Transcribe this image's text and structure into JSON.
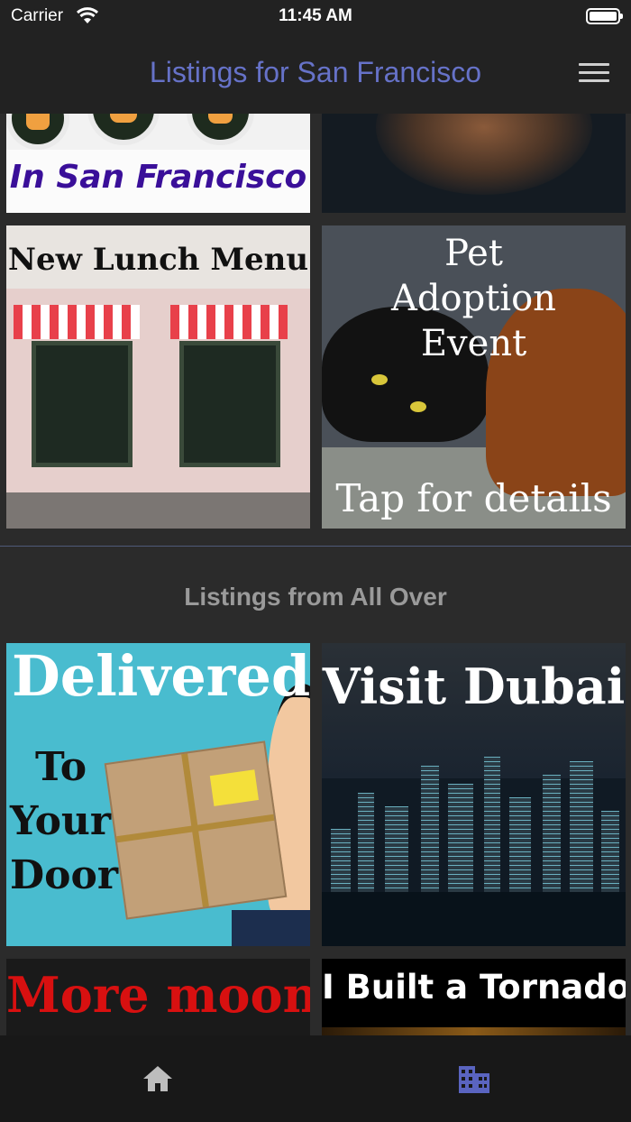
{
  "status_bar": {
    "carrier": "Carrier",
    "time": "11:45 AM",
    "battery_level": 1.0
  },
  "nav": {
    "title": "Listings for San Francisco",
    "title_color": "#6672c8",
    "menu_icon": "hamburger-menu-icon"
  },
  "local_listings": [
    {
      "caption": "In San Francisco",
      "caption_color": "#3a0f99"
    },
    {
      "caption": ""
    },
    {
      "caption": "New Lunch Menu",
      "caption_color": "#111111"
    },
    {
      "caption_top": "Pet Adoption Event",
      "caption_bottom": "Tap for details"
    }
  ],
  "section_header": "Listings from All Over",
  "global_listings": [
    {
      "caption": "Delivered",
      "words": [
        "To",
        "Your",
        "Door"
      ]
    },
    {
      "caption": "Visit Dubai"
    },
    {
      "caption": "More moon",
      "caption_color": "#d81010"
    },
    {
      "caption": "I Built a Tornado"
    }
  ],
  "tab_bar": {
    "tabs": [
      {
        "icon": "home-icon",
        "selected": false,
        "color": "#bdbdbd"
      },
      {
        "icon": "building-icon",
        "selected": true,
        "color": "#5a64c0"
      }
    ]
  }
}
